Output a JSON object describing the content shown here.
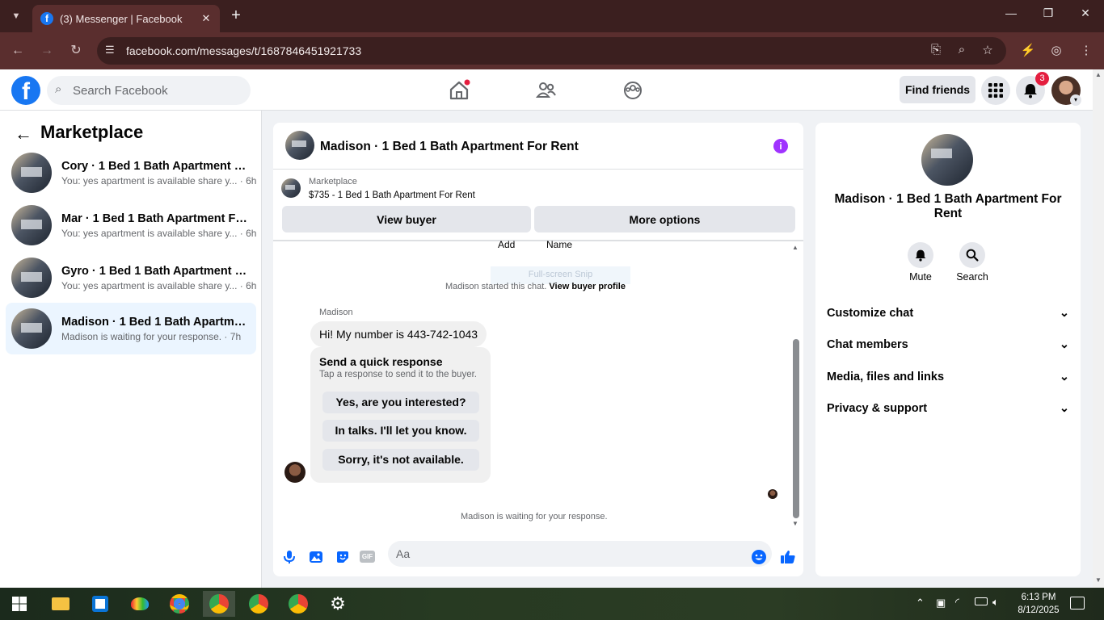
{
  "browser": {
    "tab_title": "(3) Messenger | Facebook",
    "url": "facebook.com/messages/t/1687846451921733"
  },
  "fb": {
    "search_placeholder": "Search Facebook",
    "find_friends": "Find friends",
    "notification_count": "3"
  },
  "left": {
    "title": "Marketplace",
    "conversations": [
      {
        "title": "Cory · 1 Bed 1 Bath Apartment For ...",
        "preview": "You: yes apartment is available share y...",
        "time": "6h"
      },
      {
        "title": "Mar · 1 Bed 1 Bath Apartment For ...",
        "preview": "You: yes apartment is available share y...",
        "time": "6h"
      },
      {
        "title": "Gyro · 1 Bed 1 Bath Apartment For ...",
        "preview": "You: yes apartment is available share y...",
        "time": "6h"
      },
      {
        "title": "Madison · 1 Bed 1 Bath Apartment ...",
        "preview": "Madison is waiting for your response.",
        "time": "7h"
      }
    ]
  },
  "chat": {
    "title": "Madison · 1 Bed 1 Bath Apartment For Rent",
    "listing_label": "Marketplace",
    "listing_text": "$735 - 1 Bed 1 Bath Apartment For Rent",
    "view_buyer": "View buyer",
    "more_options": "More options",
    "add_label": "Add",
    "name_label": "Name",
    "snip_text": "Full-screen Snip",
    "started_text": "Madison started this chat.",
    "view_buyer_profile": "View buyer profile",
    "sender": "Madison",
    "message": "Hi! My number is 443-742-1043",
    "quick_title": "Send a quick response",
    "quick_sub": "Tap a response to send it to the buyer.",
    "quick_responses": [
      "Yes, are you interested?",
      "In talks. I'll let you know.",
      "Sorry, it's not available."
    ],
    "waiting": "Madison is waiting for your response.",
    "composer_placeholder": "Aa"
  },
  "right": {
    "title": "Madison · 1 Bed 1 Bath Apartment For Rent",
    "mute": "Mute",
    "search": "Search",
    "sections": [
      "Customize chat",
      "Chat members",
      "Media, files and links",
      "Privacy & support"
    ]
  },
  "taskbar": {
    "time": "6:13 PM",
    "date": "8/12/2025"
  },
  "colors": {
    "brand": "#1877f2",
    "browser_frame": "#3b1f1f",
    "info_purple": "#a033ff",
    "badge_red": "#e41e3f"
  }
}
